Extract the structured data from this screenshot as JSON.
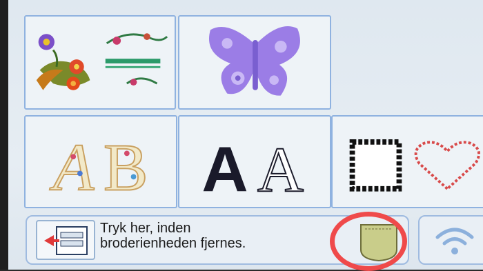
{
  "tiles": [
    {
      "label": "Blomster- og bogstavmønstre"
    },
    {
      "label": "Sommerfugl"
    },
    {
      "label": "Dekorative bogstaver"
    },
    {
      "label": "Bogstaver"
    },
    {
      "label": "Rammer"
    }
  ],
  "tile4_text": {
    "bold": "A",
    "outline": "A"
  },
  "bottom": {
    "message_line1": "Tryk her, inden",
    "message_line2": "broderienheden fjernes."
  },
  "colors": {
    "highlight": "#ef4a4a",
    "tile_border": "#8fb2e0",
    "butterfly": "#9b7de6"
  }
}
